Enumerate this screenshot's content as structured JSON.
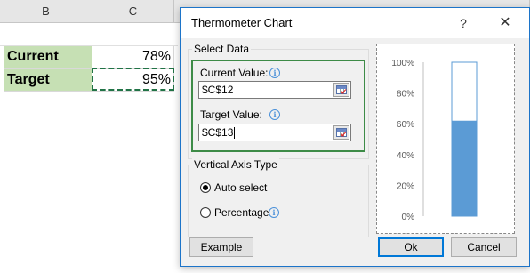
{
  "sheet": {
    "columns": [
      "B",
      "C"
    ],
    "rows": [
      {
        "label": "Current",
        "value": "78%"
      },
      {
        "label": "Target",
        "value": "95%"
      }
    ]
  },
  "dialog": {
    "title": "Thermometer Chart",
    "help_icon": "?",
    "close_icon": "✕",
    "select_data": {
      "legend": "Select Data",
      "current_label": "Current Value:",
      "current_value": "$C$12",
      "target_label": "Target Value:",
      "target_value": "$C$13"
    },
    "axis_type": {
      "legend": "Vertical Axis Type",
      "options": [
        "Auto select",
        "Percentage"
      ],
      "selected": "Auto select"
    },
    "buttons": {
      "example": "Example",
      "ok": "Ok",
      "cancel": "Cancel"
    },
    "accent_color": "#0078d7",
    "highlight_color": "#3d8b47"
  },
  "chart_data": {
    "type": "bar",
    "yticks": [
      "100%",
      "80%",
      "60%",
      "40%",
      "20%",
      "0%"
    ],
    "ylim": [
      0,
      1
    ],
    "values": [
      0.62
    ],
    "fill_color": "#5b9bd5"
  }
}
